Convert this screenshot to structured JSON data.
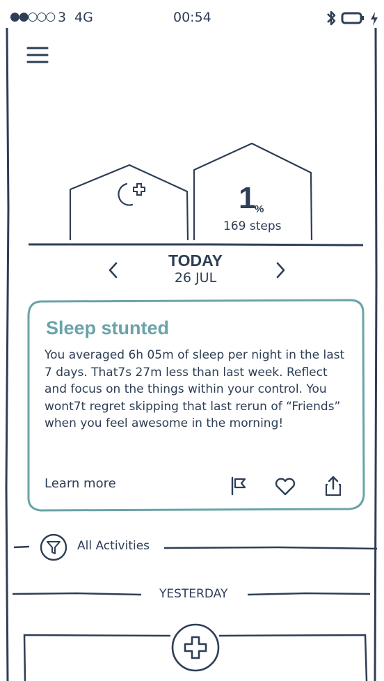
{
  "status_bar": {
    "signal": "●●○○○",
    "carrier": "3",
    "network": "4G",
    "time": "00:54"
  },
  "houses": {
    "steps_percent": "1",
    "percent_sign": "%",
    "steps_label": "169 steps"
  },
  "date_nav": {
    "day": "TODAY",
    "date": "26 JUL"
  },
  "card": {
    "title": "Sleep stunted",
    "body": "You averaged 6h 05m of sleep per night in the last 7 days. That7s 27m less than last week. Reflect and focus on the things within your control. You wont7t regret skipping that last rerun of “Friends” when you feel awesome in the morning!",
    "learn_more": "Learn more",
    "accent_color": "#6aa3a8"
  },
  "filter": {
    "label": "All Activities"
  },
  "sections": {
    "yesterday": "YESTERDAY"
  },
  "icons": {
    "menu": "hamburger-icon",
    "bluetooth": "bluetooth-icon",
    "battery": "battery-icon",
    "sleep": "moon-plus-icon",
    "prev": "chevron-left-icon",
    "next": "chevron-right-icon",
    "flag": "flag-icon",
    "like": "heart-icon",
    "share": "share-icon",
    "filter": "filter-icon",
    "add": "plus-icon"
  }
}
